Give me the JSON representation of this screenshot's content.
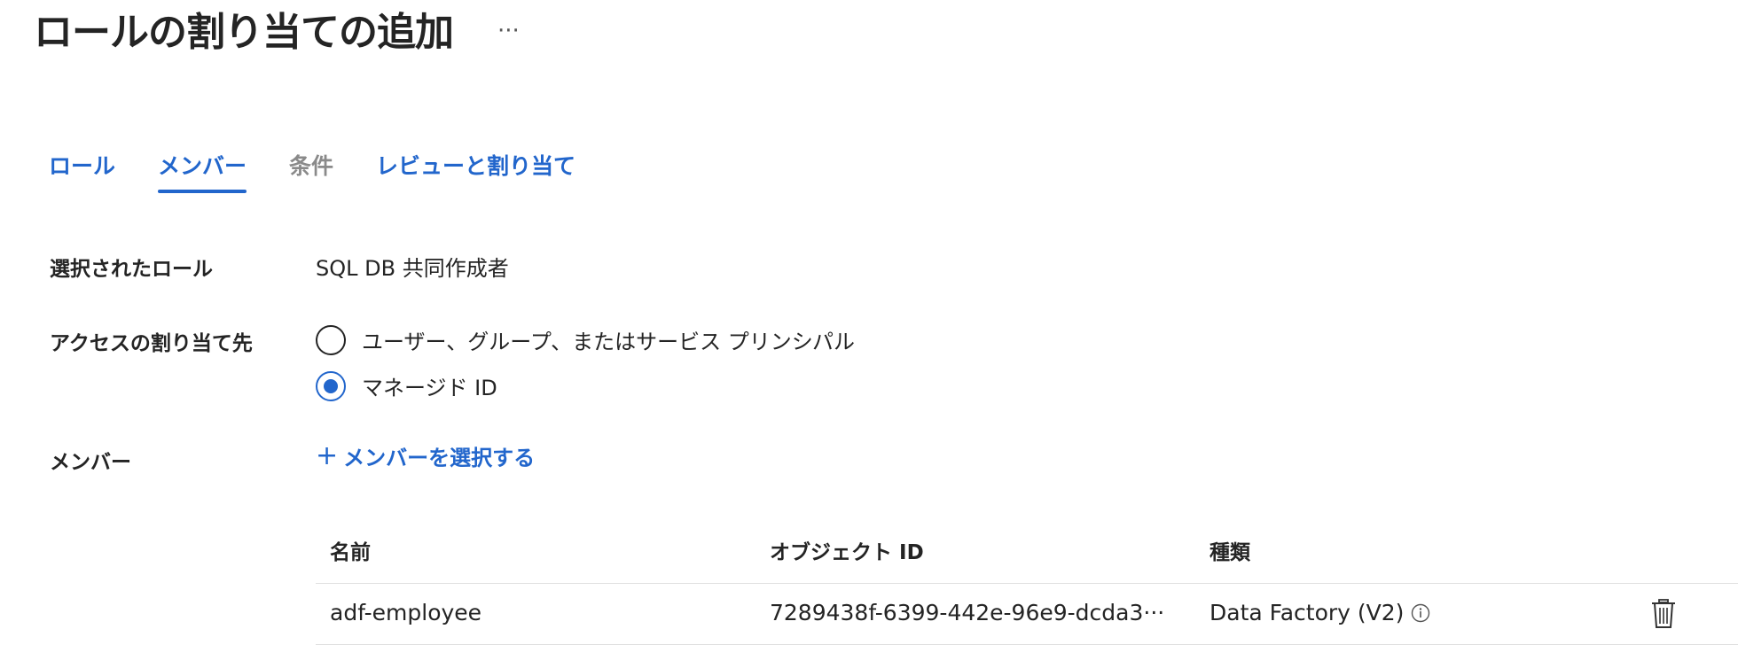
{
  "header": {
    "title": "ロールの割り当ての追加",
    "more_label": "···"
  },
  "tabs": [
    {
      "label": "ロール",
      "state": "link"
    },
    {
      "label": "メンバー",
      "state": "active"
    },
    {
      "label": "条件",
      "state": "disabled"
    },
    {
      "label": "レビューと割り当て",
      "state": "link"
    }
  ],
  "form": {
    "selected_role": {
      "label": "選択されたロール",
      "value": "SQL DB 共同作成者"
    },
    "assign_access_to": {
      "label": "アクセスの割り当て先",
      "options": [
        {
          "label": "ユーザー、グループ、またはサービス プリンシパル",
          "checked": false
        },
        {
          "label": "マネージド ID",
          "checked": true
        }
      ]
    },
    "members": {
      "label": "メンバー",
      "select_link": "メンバーを選択する",
      "select_icon": "plus-icon"
    }
  },
  "members_table": {
    "columns": [
      "名前",
      "オブジェクト ID",
      "種類"
    ],
    "rows": [
      {
        "name": "adf-employee",
        "object_id": "7289438f-6399-442e-96e9-dcda3",
        "type": "Data Factory (V2)"
      }
    ]
  },
  "colors": {
    "accent": "#2266cc",
    "disabled": "#8a8a8a",
    "text": "#242424"
  },
  "icons": {
    "info": "info-icon",
    "delete": "trash-icon",
    "more": "more-icon"
  }
}
